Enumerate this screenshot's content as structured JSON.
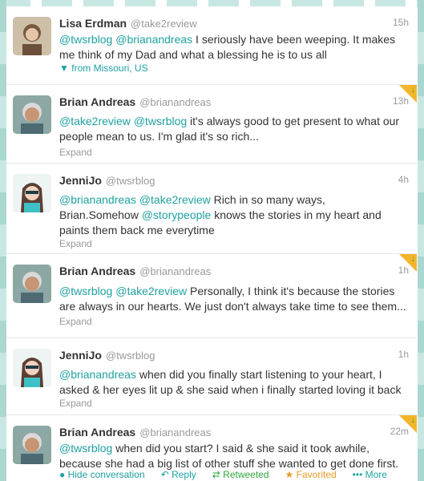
{
  "tweets": [
    {
      "fullname": "Lisa Erdman",
      "username": "@take2review",
      "time": "15h",
      "parts": [
        {
          "text": "@twsrblog",
          "mention": true
        },
        {
          "text": " "
        },
        {
          "text": "@brianandreas",
          "mention": true
        },
        {
          "text": " I seriously have been weeping.   It makes me think of my Dad and what a blessing he is to us all"
        }
      ],
      "footer": "from Missouri, US",
      "footer_type": "geo"
    },
    {
      "fullname": "Brian Andreas",
      "username": "@brianandreas",
      "time": "13h",
      "parts": [
        {
          "text": "@take2review",
          "mention": true
        },
        {
          "text": " "
        },
        {
          "text": "@twsrblog",
          "mention": true
        },
        {
          "text": " it's always good to get present to what our people mean to us. I'm glad it's so rich..."
        }
      ],
      "footer": "Expand",
      "footer_type": "expand",
      "flag": true
    },
    {
      "fullname": "JenniJo",
      "username": "@twsrblog",
      "time": "4h",
      "parts": [
        {
          "text": "@brianandreas",
          "mention": true
        },
        {
          "text": " "
        },
        {
          "text": "@take2review",
          "mention": true
        },
        {
          "text": " Rich in so many ways, Brian.Somehow "
        },
        {
          "text": "@storypeople",
          "mention": true
        },
        {
          "text": " knows the stories in my heart and paints them back me everytime"
        }
      ],
      "footer": "Expand",
      "footer_type": "expand"
    },
    {
      "fullname": "Brian Andreas",
      "username": "@brianandreas",
      "time": "1h",
      "parts": [
        {
          "text": "@twsrblog",
          "mention": true
        },
        {
          "text": " "
        },
        {
          "text": "@take2review",
          "mention": true
        },
        {
          "text": " Personally, I think it's because the stories are always in our hearts. We just don't always take time to see them..."
        }
      ],
      "footer": "Expand",
      "footer_type": "expand",
      "flag": true
    },
    {
      "fullname": "JenniJo",
      "username": "@twsrblog",
      "time": "1h",
      "parts": [
        {
          "text": "@brianandreas",
          "mention": true
        },
        {
          "text": " when did you finally start listening to your heart, I asked & her eyes lit up & she said when i finally started loving it back"
        }
      ],
      "footer": "Expand",
      "footer_type": "expand"
    },
    {
      "fullname": "Brian Andreas",
      "username": "@brianandreas",
      "time": "22m",
      "parts": [
        {
          "text": "@twsrblog",
          "mention": true
        },
        {
          "text": " when did you start? I said & she said it took awhile, because she had a big list of other stuff she wanted to get done first."
        }
      ],
      "footer_type": "actions",
      "flag": true
    }
  ],
  "actions": {
    "hide": "Hide conversation",
    "reply": "Reply",
    "retweeted": "Retweeted",
    "favorited": "Favorited",
    "more": "More"
  },
  "colors": {
    "mention": "#1fa1a2",
    "retweet": "#2ea63b",
    "favorite": "#e79a24"
  }
}
